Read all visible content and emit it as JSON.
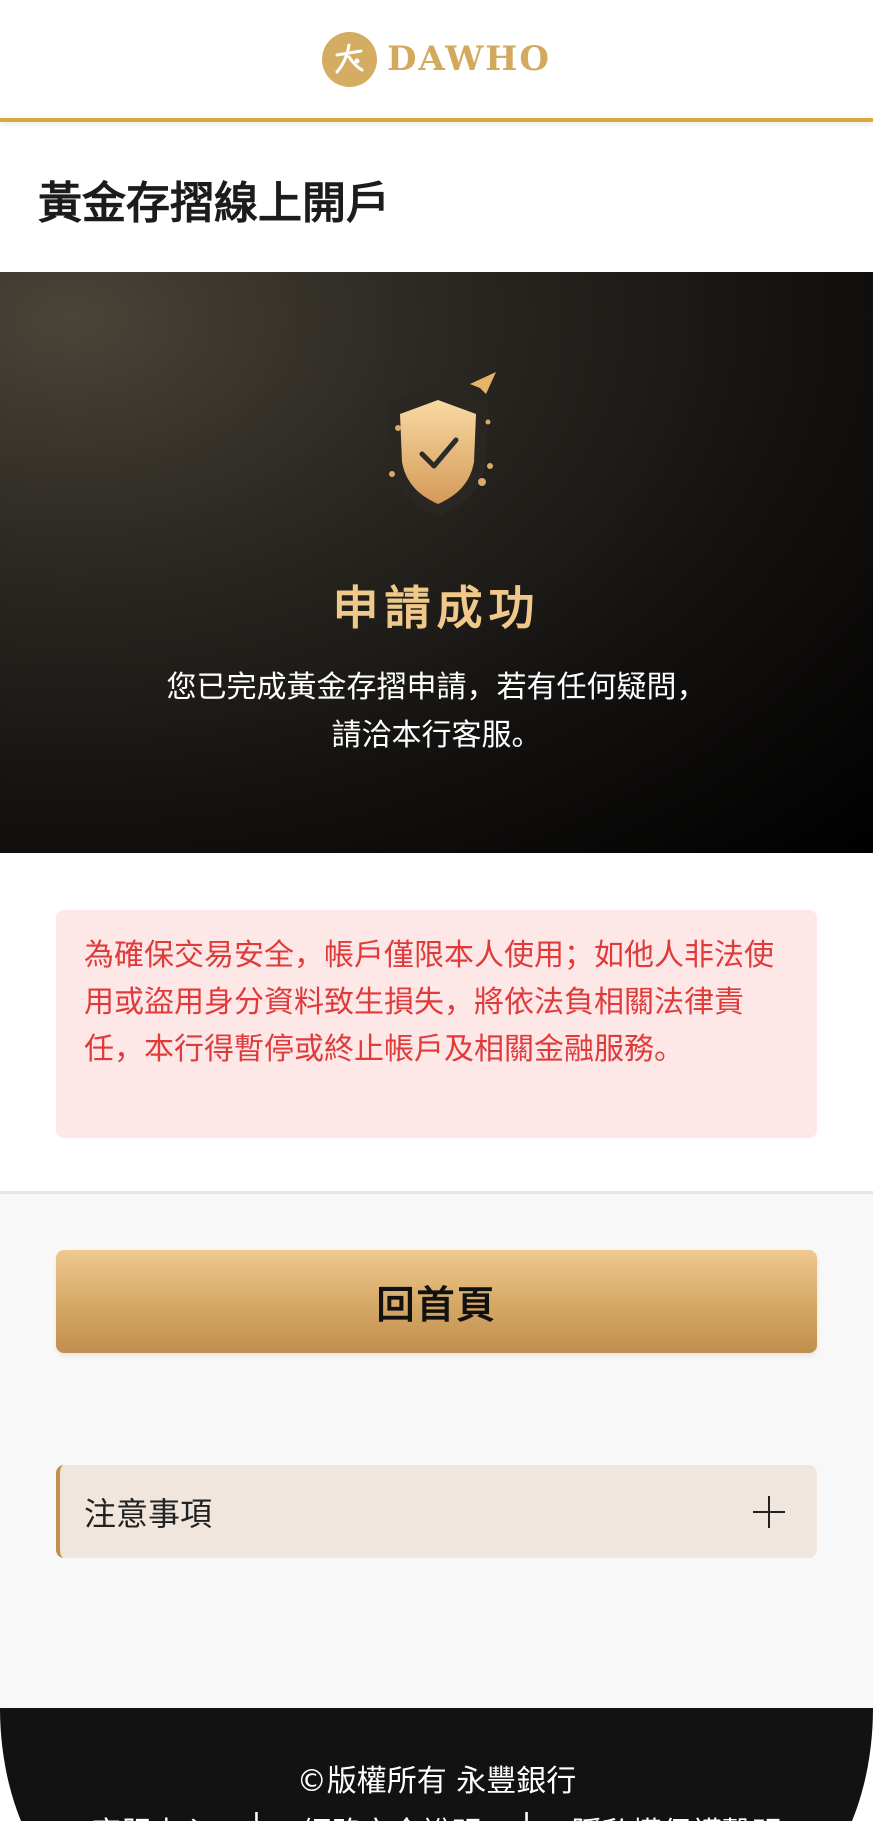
{
  "header": {
    "logo_text": "DAWHO",
    "logo_mark_text": "大戶"
  },
  "page": {
    "title": "黃金存摺線上開戶"
  },
  "hero": {
    "title": "申請成功",
    "message_line1": "您已完成黃金存摺申請，若有任何疑問，",
    "message_line2": "請洽本行客服。"
  },
  "warning": {
    "text": "為確保交易安全，帳戶僅限本人使用；如他人非法使用或盜用身分資料致生損失，將依法負相關法律責任，本行得暫停或終止帳戶及相關金融服務。"
  },
  "actions": {
    "home_label": "回首頁"
  },
  "notes": {
    "label": "注意事項"
  },
  "footer": {
    "copyright": "©版權所有 永豐銀行",
    "links": [
      {
        "label": "客服中心"
      },
      {
        "label": "網路安全說明"
      },
      {
        "label": "隱私權保護聲明"
      }
    ]
  },
  "colors": {
    "accent_gold": "#d8a93a",
    "warning_red": "#e03b3b",
    "warning_bg": "#fde7e7",
    "hero_title": "#f0c98a"
  }
}
